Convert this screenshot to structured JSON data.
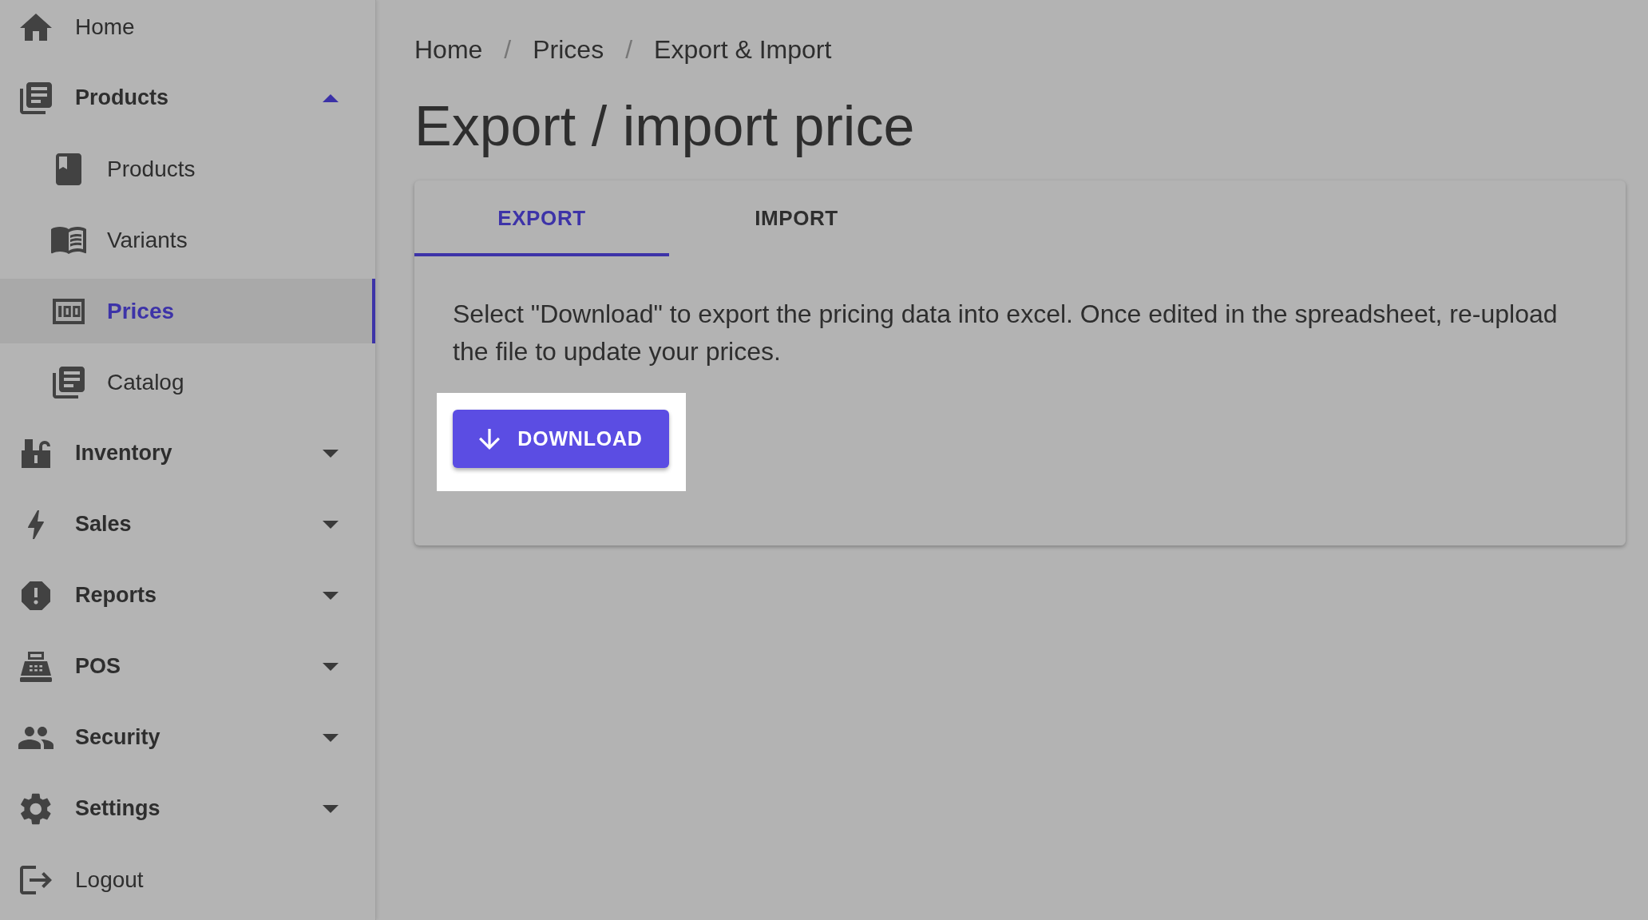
{
  "sidebar": {
    "items": [
      {
        "kind": "link",
        "label": "Home",
        "selected": false
      },
      {
        "kind": "group",
        "label": "Products",
        "selected": false,
        "expanded": true,
        "children": [
          {
            "label": "Products",
            "selected": false
          },
          {
            "label": "Variants",
            "selected": false
          },
          {
            "label": "Prices",
            "selected": true
          },
          {
            "label": "Catalog",
            "selected": false
          }
        ]
      },
      {
        "kind": "group",
        "label": "Inventory",
        "selected": false,
        "expanded": false
      },
      {
        "kind": "group",
        "label": "Sales",
        "selected": false,
        "expanded": false
      },
      {
        "kind": "group",
        "label": "Reports",
        "selected": false,
        "expanded": false
      },
      {
        "kind": "group",
        "label": "POS",
        "selected": false,
        "expanded": false
      },
      {
        "kind": "group",
        "label": "Security",
        "selected": false,
        "expanded": false
      },
      {
        "kind": "group",
        "label": "Settings",
        "selected": false,
        "expanded": false
      },
      {
        "kind": "link",
        "label": "Logout",
        "selected": false
      }
    ]
  },
  "breadcrumb": [
    {
      "kind": "link",
      "text": "Home"
    },
    {
      "kind": "separator",
      "text": "/"
    },
    {
      "kind": "link",
      "text": "Prices"
    },
    {
      "kind": "separator",
      "text": "/"
    },
    {
      "kind": "current",
      "text": "Export & Import"
    }
  ],
  "title": "Export / import price",
  "tabs": [
    {
      "label": "EXPORT",
      "selected": true
    },
    {
      "label": "IMPORT",
      "selected": false
    }
  ],
  "export_panel": {
    "description": "Select \"Download\" to export the pricing data into excel. Once edited in the spreadsheet, re-upload the file to update your prices.",
    "download_button": {
      "label": "DOWNLOAD",
      "highlighted": true
    }
  }
}
